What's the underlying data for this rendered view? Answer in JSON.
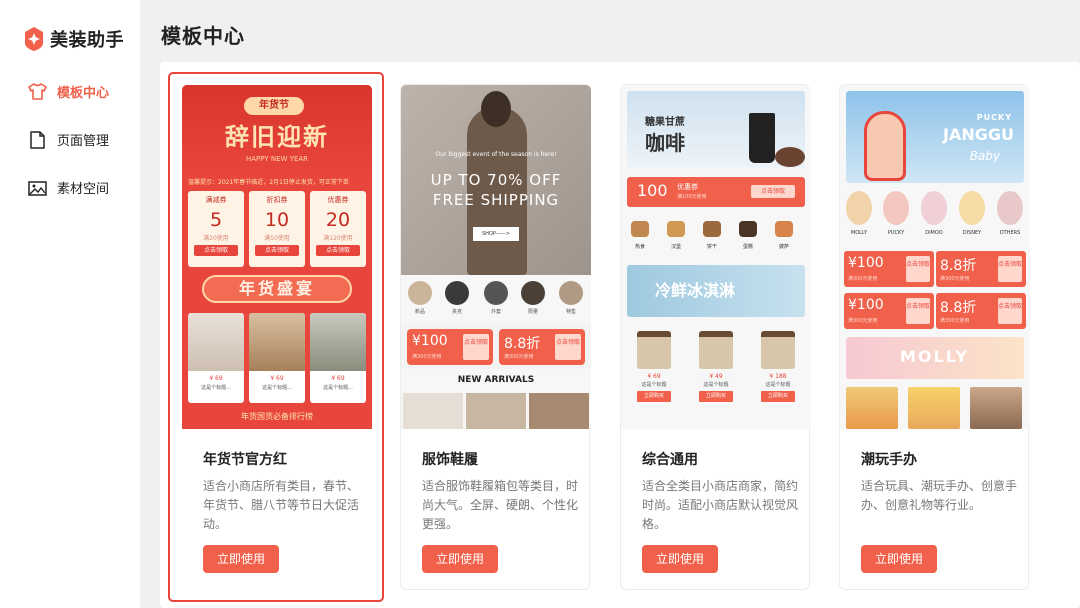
{
  "app": {
    "name": "美装助手"
  },
  "sidebar": {
    "items": [
      {
        "label": "模板中心",
        "icon": "shirt-icon",
        "active": true
      },
      {
        "label": "页面管理",
        "icon": "document-icon",
        "active": false
      },
      {
        "label": "素材空间",
        "icon": "image-icon",
        "active": false
      }
    ]
  },
  "page": {
    "title": "模板中心"
  },
  "colors": {
    "accent": "#f0604a",
    "selected_border": "#e8453c"
  },
  "templates": [
    {
      "title": "年货节官方红",
      "desc": "适合小商店所有类目，春节、年货节、腊八节等节日大促活动。",
      "button": "立即使用",
      "selected": true,
      "preview": {
        "badge": "年货节",
        "headline": "辞旧迎新",
        "sub": "HAPPY NEW YEAR",
        "notice": "温馨提示：2021年春节临近，2月1日停止发货，可正常下单",
        "coupons": [
          {
            "type": "满减券",
            "value": "5",
            "note": "满20使用",
            "action": "点击领取"
          },
          {
            "type": "折扣券",
            "value": "10",
            "note": "满50使用",
            "action": "点击领取"
          },
          {
            "type": "优惠券",
            "value": "20",
            "note": "满120使用",
            "action": "点击领取"
          }
        ],
        "banner": "年货盛宴",
        "products": [
          {
            "price": "¥ 69",
            "name": "这是个标题..."
          },
          {
            "price": "¥ 69",
            "name": "这是个标题..."
          },
          {
            "price": "¥ 69",
            "name": "这是个标题..."
          }
        ],
        "footer": "年货国货必备排行榜"
      }
    },
    {
      "title": "服饰鞋履",
      "desc": "适合服饰鞋履箱包等类目，时尚大气。全屏、硬朗、个性化更强。",
      "button": "立即使用",
      "selected": false,
      "preview": {
        "line1": "Our biggest event of the season is here!",
        "line2": "UP TO 70% OFF",
        "line3": "FREE SHIPPING",
        "shop": "SHOP——>",
        "categories": [
          "新品",
          "夹克",
          "外套",
          "限量",
          "特售"
        ],
        "vouchers": [
          {
            "value": "¥100",
            "note": "满300元使用",
            "action": "点击领取"
          },
          {
            "value": "8.8折",
            "note": "满300元使用",
            "action": "点击领取"
          }
        ],
        "section": "NEW ARRIVALS"
      }
    },
    {
      "title": "综合通用",
      "desc": "适合全类目小商店商家，简约时尚。适配小商店默认视觉风格。",
      "button": "立即使用",
      "selected": false,
      "preview": {
        "hero_small": "糖果甘蔗",
        "hero_big": "咖啡",
        "coupon": {
          "value": "100",
          "label": "优惠券",
          "note": "满100元使用",
          "action": "点击领取"
        },
        "foods": [
          "热食",
          "汉堡",
          "饼干",
          "蛋糕",
          "披萨"
        ],
        "ice_banner": "冷鲜冰淇淋",
        "items": [
          {
            "price": "¥ 69",
            "name": "这是个标题",
            "action": "立即购买"
          },
          {
            "price": "¥ 49",
            "name": "这是个标题",
            "action": "立即购买"
          },
          {
            "price": "¥ 188",
            "name": "这是个标题",
            "action": "立即购买"
          }
        ]
      }
    },
    {
      "title": "潮玩手办",
      "desc": "适合玩具、潮玩手办、创意手办、创意礼物等行业。",
      "button": "立即使用",
      "selected": false,
      "preview": {
        "hero1": "PUCKY",
        "hero2": "JANGGU",
        "hero3": "Baby",
        "toys": [
          "MOLLY",
          "PUCKY",
          "DIMOO",
          "DISNEY",
          "OTHERS"
        ],
        "vouchers": [
          {
            "value": "¥100",
            "note": "满300元使用",
            "action": "点击领取"
          },
          {
            "value": "8.8折",
            "note": "满300元使用",
            "action": "点击领取"
          },
          {
            "value": "¥100",
            "note": "满300元使用",
            "action": "点击领取"
          },
          {
            "value": "8.8折",
            "note": "满300元使用",
            "action": "点击领取"
          }
        ],
        "banner": "MOLLY"
      }
    }
  ]
}
